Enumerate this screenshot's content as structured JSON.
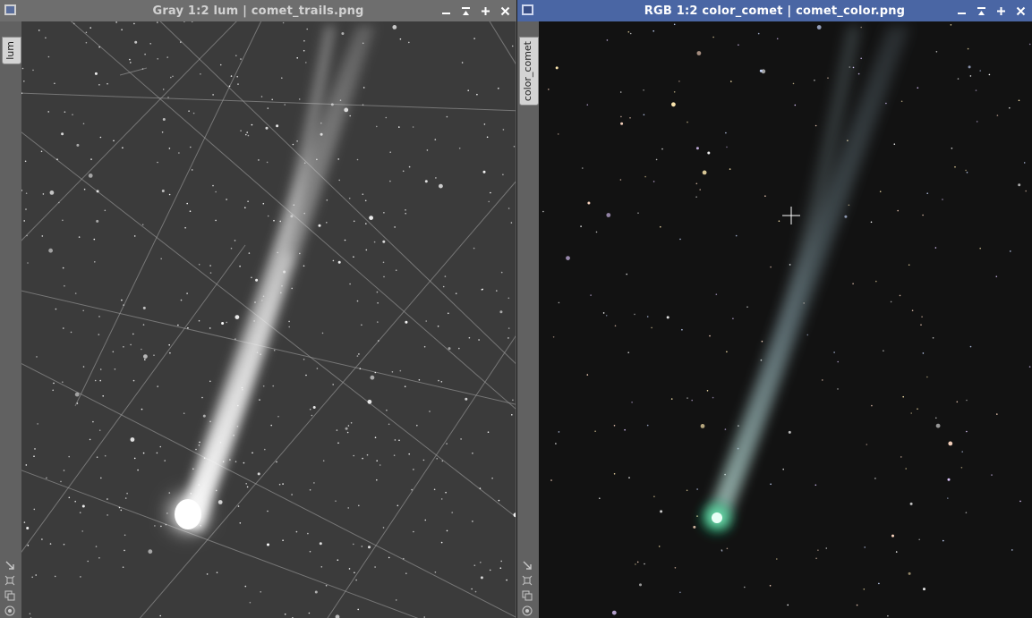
{
  "windows": {
    "left": {
      "title": "Gray 1:2 lum | comet_trails.png",
      "tab_label": "lum",
      "active": false,
      "image_description_icon": "grayscale-comet-image"
    },
    "right": {
      "title": "RGB 1:2 color_comet | comet_color.png",
      "tab_label": "color_comet",
      "active": true,
      "image_description_icon": "color-comet-image"
    }
  },
  "controls": [
    "minimize-icon",
    "shade-icon",
    "maximize-icon",
    "close-icon"
  ],
  "sidebar_icons": [
    "fit-view-icon",
    "zoom-icon",
    "clone-icon",
    "settings-icon"
  ],
  "colors": {
    "active_titlebar": "#4a66a4",
    "inactive_titlebar": "#6e6e6e",
    "comet_nucleus": "#22d08a"
  }
}
